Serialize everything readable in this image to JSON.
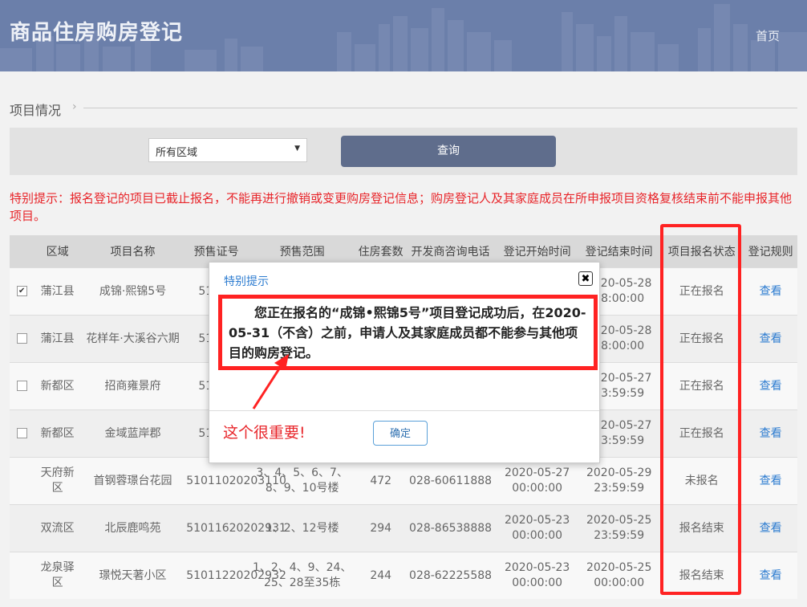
{
  "header": {
    "title": "商品住房购房登记",
    "home_link": "首页"
  },
  "section": {
    "title": "项目情况"
  },
  "filter": {
    "region_value": "所有区域",
    "query_label": "查询"
  },
  "notice": "特别提示：报名登记的项目已截止报名，不能再进行撤销或变更购房登记信息；购房登记人及其家庭成员在所申报项目资格复核结束前不能申报其他项目。",
  "table": {
    "headers": [
      "",
      "区域",
      "项目名称",
      "预售证号",
      "预售范围",
      "住房套数",
      "开发商咨询电话",
      "登记开始时间",
      "登记结束时间",
      "项目报名状态",
      "登记规则"
    ],
    "rows": [
      {
        "checked": true,
        "region": "蒲江县",
        "name": "成锦·熙锦5号",
        "cert": "51020",
        "range": "",
        "count": "",
        "phone": "",
        "start": "",
        "end": "2020-05-28 18:00:00",
        "status": "正在报名",
        "rule": "查看"
      },
      {
        "checked": false,
        "region": "蒲江县",
        "name": "花样年·大溪谷六期",
        "cert": "51020",
        "range": "",
        "count": "",
        "phone": "",
        "start": "",
        "end": "2020-05-28 18:00:00",
        "status": "正在报名",
        "rule": "查看"
      },
      {
        "checked": false,
        "region": "新都区",
        "name": "招商雍景府",
        "cert": "51020",
        "range": "",
        "count": "",
        "phone": "",
        "start": "",
        "end": "2020-05-27 23:59:59",
        "status": "正在报名",
        "rule": "查看"
      },
      {
        "checked": false,
        "region": "新都区",
        "name": "金域蓝岸郡",
        "cert": "51020",
        "range": "",
        "count": "",
        "phone": "",
        "start": "",
        "end": "2020-05-27 23:59:59",
        "status": "正在报名",
        "rule": "查看"
      },
      {
        "checked": null,
        "region": "天府新区",
        "name": "首钢蓉璟台花园",
        "cert": "51011020203110",
        "range": "3、4、5、6、7、8、9、10号楼",
        "count": "472",
        "phone": "028-60611888",
        "start": "2020-05-27 00:00:00",
        "end": "2020-05-29 23:59:59",
        "status": "未报名",
        "rule": "查看"
      },
      {
        "checked": null,
        "region": "双流区",
        "name": "北辰鹿鸣苑",
        "cert": "51011620202931",
        "range": "1、2、12号楼",
        "count": "294",
        "phone": "028-86538888",
        "start": "2020-05-23 00:00:00",
        "end": "2020-05-25 23:59:59",
        "status": "报名结束",
        "rule": "查看"
      },
      {
        "checked": null,
        "region": "龙泉驿区",
        "name": "璟悦天著小区",
        "cert": "51011220202932",
        "range": "1、2、4、9、24、25、28至35栋",
        "count": "244",
        "phone": "028-62225588",
        "start": "2020-05-23 00:00:00",
        "end": "2020-05-25 00:00:00",
        "status": "报名结束",
        "rule": "查看"
      }
    ]
  },
  "modal": {
    "title": "特别提示",
    "message": "您正在报名的“成锦•熙锦5号”项目登记成功后，在2020-05-31（不含）之前，申请人及其家庭成员都不能参与其他项目的购房登记。",
    "annotation": "这个很重要!",
    "ok_label": "确定"
  },
  "colors": {
    "header_bg": "#6b7faa",
    "accent_red": "#e8262b",
    "link_blue": "#2d7cd0",
    "query_btn": "#5f6d8c"
  }
}
